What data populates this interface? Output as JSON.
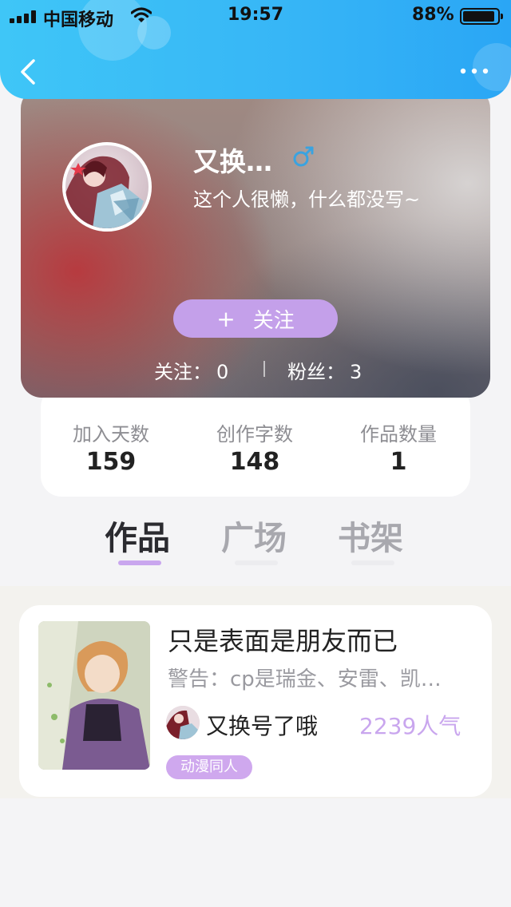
{
  "status_bar": {
    "carrier": "中国移动",
    "time": "19:57",
    "battery": "88%",
    "battery_level": 0.88
  },
  "nav": {
    "back_icon": "chevron-left-icon",
    "more_icon": "more-dots-icon"
  },
  "profile": {
    "username": "又换…",
    "gender_icon": "male-icon",
    "bio": "这个人很懒，什么都没写~",
    "follow_button": "关注",
    "follow_plus": "+",
    "following_label": "关注：",
    "following_count": "0",
    "fans_label": "粉丝：",
    "fans_count": "3"
  },
  "stats": [
    {
      "label": "加入天数",
      "value": "159"
    },
    {
      "label": "创作字数",
      "value": "148"
    },
    {
      "label": "作品数量",
      "value": "1"
    }
  ],
  "tabs": [
    {
      "label": "作品",
      "active": true
    },
    {
      "label": "广场",
      "active": false
    },
    {
      "label": "书架",
      "active": false
    }
  ],
  "works": [
    {
      "title": "只是表面是朋友而已",
      "description": "警告：cp是瑞金、安雷、凯…",
      "author": "又换号了哦",
      "popularity": "2239人气",
      "tag": "动漫同人"
    }
  ],
  "colors": {
    "header_gradient_start": "#3fc6f7",
    "header_gradient_end": "#2aa6f5",
    "accent_purple": "#c4a0ea",
    "male_blue": "#3aa3e0"
  }
}
